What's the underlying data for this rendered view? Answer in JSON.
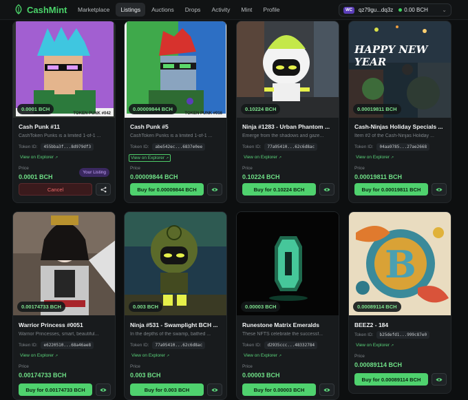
{
  "brand": {
    "name": "CashMint"
  },
  "nav": {
    "items": [
      "Marketplace",
      "Listings",
      "Auctions",
      "Drops",
      "Activity",
      "Mint",
      "Profile"
    ],
    "active": "Listings"
  },
  "wallet": {
    "badge": "WC",
    "address": "qz79gu...dq3z",
    "balance": "0.00 BCH"
  },
  "labels": {
    "token_id": "Token ID:",
    "view_explorer": "View on Explorer",
    "price": "Price",
    "your_listing": "Your Listing",
    "cancel": "Cancel"
  },
  "colors": {
    "accent": "#4fd26e",
    "brand": "#4bd46a",
    "cancel": "#f06a6a",
    "background": "#0d0f10",
    "card": "#181b1d"
  },
  "cards": [
    {
      "title": "Cash Punk #11",
      "desc": "CashToken Punks is a limited 1-of-1 ...",
      "token": "455bba3f...8d979df3",
      "price_pill": "0.0001 BCH",
      "price": "0.0001 BCH",
      "action": "cancel",
      "art_caption": "TOKEN PUNK #042"
    },
    {
      "title": "Cash Punk #5",
      "desc": "CashToken Punks is a limited 1-of-1 ...",
      "token": "abe542ec...6837e0ee",
      "price_pill": "0.00009844 BCH",
      "price": "0.00009844 BCH",
      "action": "buy",
      "buy_label": "Buy for 0.00009844 BCH",
      "art_caption": "TOKEN PUNK #016"
    },
    {
      "title": "Ninja #1283 - Urban Phantom ...",
      "desc": "Emerge from the shadows and gaze...",
      "token": "77a95410...62c6d8ac",
      "price_pill": "0.10224 BCH",
      "price": "0.10224 BCH",
      "action": "buy",
      "buy_label": "Buy for 0.10224 BCH"
    },
    {
      "title": "Cash-Ninjas Holiday Specials ...",
      "desc": "Item #2 of the Cash-Ninjas Holiday ...",
      "token": "04aa9785...27ae2668",
      "price_pill": "0.00019811 BCH",
      "price": "0.00019811 BCH",
      "action": "buy",
      "buy_label": "Buy for 0.00019811 BCH",
      "art_caption": "HAPPY NEW YEAR"
    },
    {
      "title": "Warrior Princess #0051",
      "desc": "Warrior Princesses, smart, beautiful...",
      "token": "e6220510...68a46ae8",
      "price_pill": "0.00174733 BCH",
      "price": "0.00174733 BCH",
      "action": "buy",
      "buy_label": "Buy for 0.00174733 BCH"
    },
    {
      "title": "Ninja #531 - Swamplight BCH ...",
      "desc": "In the depths of the swamp, bathed ...",
      "token": "77a95410...62c6d8ac",
      "price_pill": "0.003 BCH",
      "price": "0.003 BCH",
      "action": "buy",
      "buy_label": "Buy for 0.003 BCH"
    },
    {
      "title": "Runestone Matrix Emeralds",
      "desc": "These NFTS celebrate the successf...",
      "token": "d2935ccc...48332784",
      "price_pill": "0.00003 BCH",
      "price": "0.00003 BCH",
      "action": "buy",
      "buy_label": "Buy for 0.00003 BCH"
    },
    {
      "title": "BEEZ2 - 184",
      "desc": "",
      "token": "b25defd1...999c87e0",
      "price_pill": "0.00089114 BCH",
      "price": "0.00089114 BCH",
      "action": "buy",
      "buy_label": "Buy for 0.00089114 BCH"
    }
  ]
}
